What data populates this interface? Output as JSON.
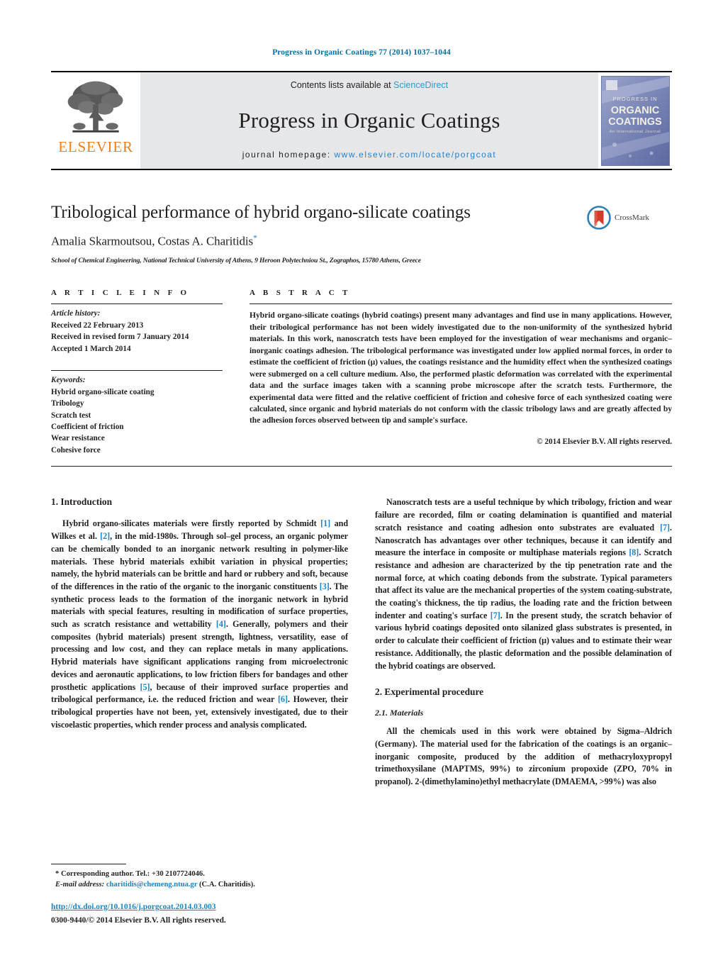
{
  "running_head": "Progress in Organic Coatings 77 (2014) 1037–1044",
  "masthead": {
    "publisher_name": "ELSEVIER",
    "contents_prefix": "Contents lists available at ",
    "contents_link": "ScienceDirect",
    "journal_title": "Progress in Organic Coatings",
    "homepage_prefix": "journal homepage: ",
    "homepage_url": "www.elsevier.com/locate/porgcoat",
    "cover_lines": [
      "PROGRESS IN",
      "ORGANIC",
      "COATINGS",
      "An International Journal"
    ]
  },
  "article": {
    "title": "Tribological performance of hybrid organo-silicate coatings",
    "authors": "Amalia Skarmoutsou, Costas A. Charitidis",
    "corresponding_marker": "*",
    "affiliation": "School of Chemical Engineering, National Technical University of Athens, 9 Heroon Polytechniou St., Zographos, 15780 Athens, Greece",
    "crossmark_label": "CrossMark"
  },
  "article_info": {
    "heading": "A R T I C L E   I N F O",
    "history_label": "Article history:",
    "history": [
      "Received 22 February 2013",
      "Received in revised form 7 January 2014",
      "Accepted 1 March 2014"
    ],
    "keywords_label": "Keywords:",
    "keywords": [
      "Hybrid organo-silicate coating",
      "Tribology",
      "Scratch test",
      "Coefficient of friction",
      "Wear resistance",
      "Cohesive force"
    ]
  },
  "abstract": {
    "heading": "A B S T R A C T",
    "text": "Hybrid organo-silicate coatings (hybrid coatings) present many advantages and find use in many applications. However, their tribological performance has not been widely investigated due to the non-uniformity of the synthesized hybrid materials. In this work, nanoscratch tests have been employed for the investigation of wear mechanisms and organic–inorganic coatings adhesion. The tribological performance was investigated under low applied normal forces, in order to estimate the coefficient of friction (μ) values, the coatings resistance and the humidity effect when the synthesized coatings were submerged on a cell culture medium. Also, the performed plastic deformation was correlated with the experimental data and the surface images taken with a scanning probe microscope after the scratch tests. Furthermore, the experimental data were fitted and the relative coefficient of friction and cohesive force of each synthesized coating were calculated, since organic and hybrid materials do not conform with the classic tribology laws and are greatly affected by the adhesion forces observed between tip and sample's surface.",
    "copyright": "© 2014 Elsevier B.V. All rights reserved."
  },
  "body": {
    "intro_heading": "1.  Introduction",
    "intro_p1_a": "Hybrid organo-silicates materials were firstly reported by Schmidt ",
    "intro_p1_r1": "[1]",
    "intro_p1_b": " and Wilkes et al. ",
    "intro_p1_r2": "[2]",
    "intro_p1_c": ", in the mid-1980s. Through sol–gel process, an organic polymer can be chemically bonded to an inorganic network resulting in polymer-like materials. These hybrid materials exhibit variation in physical properties; namely, the hybrid materials can be brittle and hard or rubbery and soft, because of the differences in the ratio of the organic to the inorganic constituents ",
    "intro_p1_r3": "[3]",
    "intro_p1_d": ". The synthetic process leads to the formation of the inorganic network in hybrid materials with special features, resulting in modification of surface properties, such as scratch resistance and wettability ",
    "intro_p1_r4": "[4]",
    "intro_p1_e": ". Generally, polymers and their composites (hybrid materials) present strength, lightness, versatility, ease of processing and low cost, and they can replace metals in many applications. Hybrid materials have significant applications ranging from microelectronic devices and aeronautic applications, to low friction fibers for bandages and other prosthetic applications ",
    "intro_p1_r5": "[5]",
    "intro_p1_f": ", because of their improved surface properties and tribological performance, i.e. the reduced friction and wear ",
    "intro_p1_r6": "[6]",
    "intro_p1_g": ". However, their tribological properties have not been, yet, extensively investigated, due to their viscoelastic properties, which render process and analysis complicated.",
    "right_p1_a": "Nanoscratch tests are a useful technique by which tribology, friction and wear failure are recorded, film or coating delamination is quantified and material scratch resistance and coating adhesion onto substrates are evaluated ",
    "right_p1_r7": "[7]",
    "right_p1_b": ". Nanoscratch has advantages over other techniques, because it can identify and measure the interface in composite or multiphase materials regions ",
    "right_p1_r8": "[8]",
    "right_p1_c": ". Scratch resistance and adhesion are characterized by the tip penetration rate and the normal force, at which coating debonds from the substrate. Typical parameters that affect its value are the mechanical properties of the system coating-substrate, the coating's thickness, the tip radius, the loading rate and the friction between indenter and coating's surface ",
    "right_p1_r7b": "[7]",
    "right_p1_d": ". In the present study, the scratch behavior of various hybrid coatings deposited onto silanized glass substrates is presented, in order to calculate their coefficient of friction (μ) values and to estimate their wear resistance. Additionally, the plastic deformation and the possible delamination of the hybrid coatings are observed.",
    "exp_heading": "2.  Experimental procedure",
    "materials_heading": "2.1.  Materials",
    "materials_p1": "All the chemicals used in this work were obtained by Sigma–Aldrich (Germany). The material used for the fabrication of the coatings is an organic–inorganic composite, produced by the addition of methacryloxypropyl trimethoxysilane (MAPTMS, 99%) to zirconium propoxide (ZPO, 70% in propanol). 2-(dimethylamino)ethyl methacrylate (DMAEMA, >99%) was also"
  },
  "footnotes": {
    "corresponding": "*  Corresponding author. Tel.: +30 2107724046.",
    "email_label": "E-mail address:",
    "email": "charitidis@chemeng.ntua.gr",
    "email_suffix": " (C.A. Charitidis).",
    "doi": "http://dx.doi.org/10.1016/j.porgcoat.2014.03.003",
    "issn": "0300-9440/© 2014 Elsevier B.V. All rights reserved."
  },
  "colors": {
    "link": "#1a84c7",
    "masthead_band": "#e6e7e8",
    "elsevier_orange": "#f07f1a",
    "running_head": "#0b6c9e"
  }
}
